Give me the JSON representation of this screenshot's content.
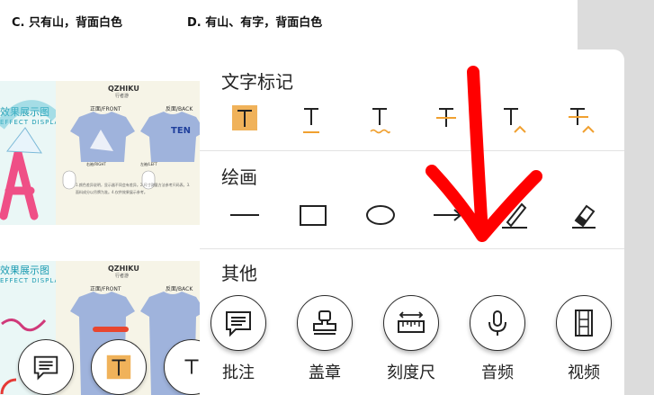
{
  "options": {
    "c": "C. 只有山，背面白色",
    "d": "D. 有山、有字，背面白色"
  },
  "thumbnails": [
    {
      "caption": "效果展示图",
      "caption_en": "EFFECT DISPLAY",
      "brand": "QZHIKU",
      "brand_sub": "行者游",
      "front_label": "正面/FRONT",
      "back_label": "反面/BACK",
      "right_label": "右袖/RIGHT",
      "left_label": "左袖/LEFT",
      "notes": "1.颜色差异说明，显示器不同会有差异。2.尺寸测量方法参考尺码表。3.面料成分以吊牌为准。4.仅供效果展示参考。"
    },
    {
      "caption": "效果展示图",
      "caption_en": "EFFECT DISPLAY",
      "brand": "QZHIKU",
      "brand_sub": "行者游",
      "front_label": "正面/FRONT",
      "back_label": "反面/BACK"
    }
  ],
  "panel": {
    "text_mark_title": "文字标记",
    "drawing_title": "绘画",
    "other_title": "其他",
    "text_tools": [
      "highlight-text-icon",
      "underline-text-icon",
      "squiggly-underline-icon",
      "strikethrough-icon",
      "insert-caret-icon",
      "replace-text-icon"
    ],
    "draw_tools": [
      "line-icon",
      "rectangle-icon",
      "ellipse-icon",
      "arrow-icon",
      "pencil-icon",
      "eraser-icon"
    ],
    "other_tools": [
      {
        "label": "批注",
        "icon": "comment-icon"
      },
      {
        "label": "盖章",
        "icon": "stamp-icon"
      },
      {
        "label": "刻度尺",
        "icon": "ruler-icon"
      },
      {
        "label": "音频",
        "icon": "microphone-icon"
      },
      {
        "label": "视频",
        "icon": "film-icon"
      }
    ]
  },
  "colors": {
    "highlight": "#f0b25a",
    "accent_orange": "#f0a030",
    "arrow_red": "#ff0000",
    "gray_strip": "#dcdcdc"
  }
}
